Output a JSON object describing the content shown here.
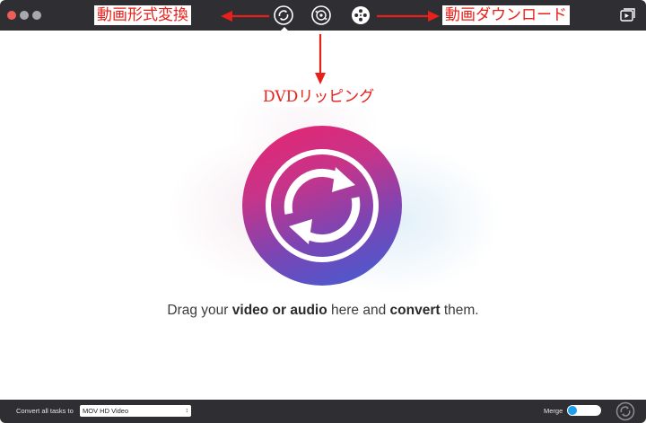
{
  "window": {
    "traffic_lights": [
      "close",
      "minimize",
      "zoom"
    ]
  },
  "toolbar": {
    "tabs": [
      {
        "name": "convert",
        "icon": "convert-icon"
      },
      {
        "name": "dvd-rip",
        "icon": "dvd-rip-icon"
      },
      {
        "name": "download",
        "icon": "download-reel-icon"
      }
    ],
    "right_icon": "media-browser-icon"
  },
  "annotations": {
    "convert": "動画形式変換",
    "download": "動画ダウンロード",
    "dvd": "DVDリッピング",
    "color": "#e8201a"
  },
  "main": {
    "drop_icon": "convert-arrows-icon",
    "drop_text": {
      "part1": "Drag your ",
      "part2": "video or audio",
      "part3": " here and ",
      "part4": "convert",
      "part5": " them."
    },
    "gradient": [
      "#e8246f",
      "#7a45b4",
      "#3f5fd6"
    ]
  },
  "bottom": {
    "convert_label": "Convert all tasks to",
    "format_value": "MOV HD Video",
    "merge_label": "Merge",
    "merge_on": true,
    "start_icon": "convert-start-icon"
  }
}
